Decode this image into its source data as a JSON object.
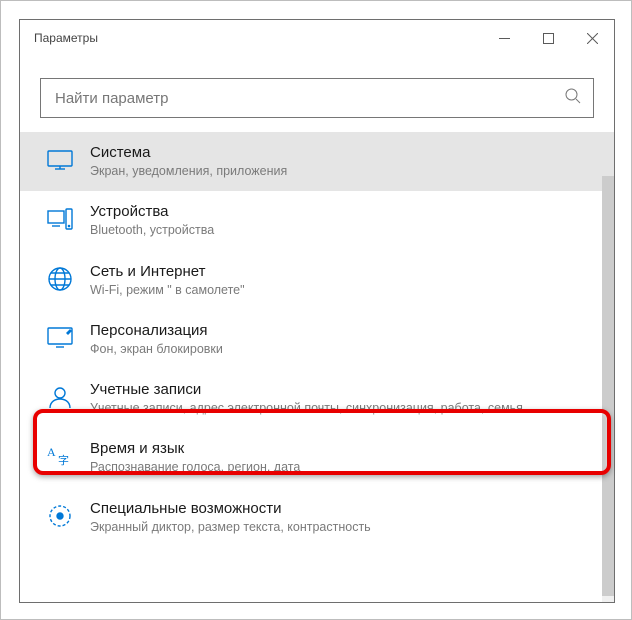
{
  "window": {
    "title": "Параметры"
  },
  "search": {
    "placeholder": "Найти параметр"
  },
  "items": [
    {
      "id": "system",
      "title": "Система",
      "sub": "Экран, уведомления, приложения",
      "selected": true,
      "highlighted": false
    },
    {
      "id": "devices",
      "title": "Устройства",
      "sub": "Bluetooth, устройства",
      "selected": false,
      "highlighted": false
    },
    {
      "id": "network",
      "title": "Сеть и Интернет",
      "sub": "Wi-Fi, режим \" в самолете\"",
      "selected": false,
      "highlighted": false
    },
    {
      "id": "personalization",
      "title": "Персонализация",
      "sub": "Фон, экран блокировки",
      "selected": false,
      "highlighted": false
    },
    {
      "id": "accounts",
      "title": "Учетные записи",
      "sub": "Учетные записи, адрес электронной почты, синхронизация, работа, семья",
      "selected": false,
      "highlighted": true
    },
    {
      "id": "timelang",
      "title": "Время и язык",
      "sub": "Распознавание голоса, регион, дата",
      "selected": false,
      "highlighted": false
    },
    {
      "id": "ease",
      "title": "Специальные возможности",
      "sub": "Экранный диктор, размер текста, контрастность",
      "selected": false,
      "highlighted": false
    }
  ]
}
